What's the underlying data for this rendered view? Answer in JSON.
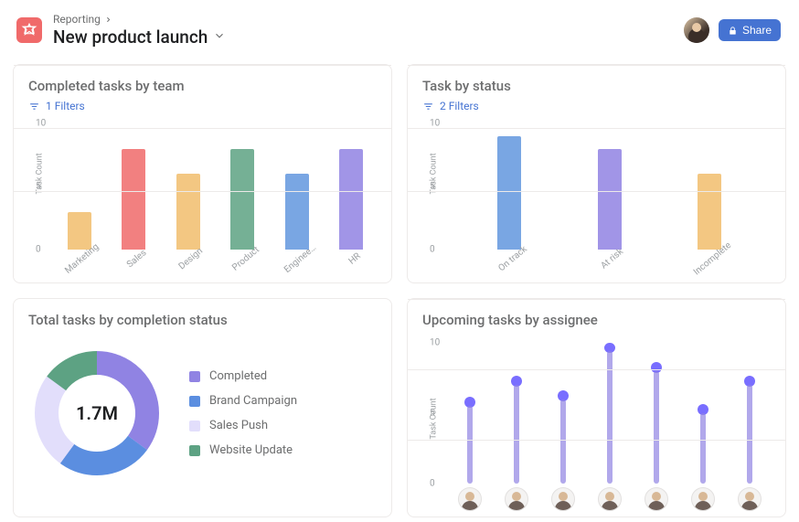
{
  "header": {
    "breadcrumb": "Reporting",
    "title": "New product launch",
    "share_label": "Share"
  },
  "cards": {
    "completed": {
      "title": "Completed tasks by team",
      "filters_label": "1 Filters",
      "ylabel": "Task Count"
    },
    "status": {
      "title": "Task by status",
      "filters_label": "2 Filters",
      "ylabel": "Task Count"
    },
    "total": {
      "title": "Total tasks by completion status",
      "center_value": "1.7M",
      "legend": [
        "Completed",
        "Brand Campaign",
        "Sales Push",
        "Website Update"
      ]
    },
    "upcoming": {
      "title": "Upcoming tasks by assignee",
      "ylabel": "Task Count"
    }
  },
  "colors": {
    "orange": "#f1bd6c",
    "red": "#f06a6a",
    "yellow": "#f1bd6c",
    "green": "#5da283",
    "blue": "#6296de",
    "purple": "#9083e3",
    "lilac": "#e2defb",
    "donut_blue": "#5b8ee0",
    "donut_green": "#5da283"
  },
  "chart_data": [
    {
      "id": "completed_by_team",
      "type": "bar",
      "title": "Completed tasks by team",
      "ylabel": "Task Count",
      "ylim": [
        0,
        10
      ],
      "yticks": [
        0,
        5,
        10
      ],
      "categories": [
        "Marketing",
        "Sales",
        "Design",
        "Product",
        "Enginee…",
        "HR"
      ],
      "values": [
        3,
        8,
        6,
        8,
        6,
        8
      ],
      "bar_colors": [
        "#f1bd6c",
        "#f06a6a",
        "#f1bd6c",
        "#5da283",
        "#6296de",
        "#9083e3"
      ]
    },
    {
      "id": "task_by_status",
      "type": "bar",
      "title": "Task by status",
      "ylabel": "Task Count",
      "ylim": [
        0,
        10
      ],
      "yticks": [
        0,
        5,
        10
      ],
      "categories": [
        "On track",
        "At risk",
        "Incomplete"
      ],
      "values": [
        9,
        8,
        6
      ],
      "bar_colors": [
        "#6296de",
        "#9083e3",
        "#f1bd6c"
      ]
    },
    {
      "id": "total_by_completion",
      "type": "pie",
      "title": "Total tasks by completion status",
      "center_label": "1.7M",
      "series": [
        {
          "name": "Completed",
          "value": 35,
          "color": "#9083e3"
        },
        {
          "name": "Brand Campaign",
          "value": 25,
          "color": "#5b8ee0"
        },
        {
          "name": "Sales Push",
          "value": 25,
          "color": "#e2defb"
        },
        {
          "name": "Website Update",
          "value": 15,
          "color": "#5da283"
        }
      ]
    },
    {
      "id": "upcoming_by_assignee",
      "type": "lollipop",
      "title": "Upcoming tasks by assignee",
      "ylabel": "Task Count",
      "ylim": [
        0,
        10
      ],
      "yticks": [
        0,
        5,
        10
      ],
      "categories": [
        "assignee-1",
        "assignee-2",
        "assignee-3",
        "assignee-4",
        "assignee-5",
        "assignee-6",
        "assignee-7"
      ],
      "values": [
        5.5,
        7,
        6,
        10,
        8,
        5,
        7
      ],
      "color": "#9083e3"
    }
  ]
}
